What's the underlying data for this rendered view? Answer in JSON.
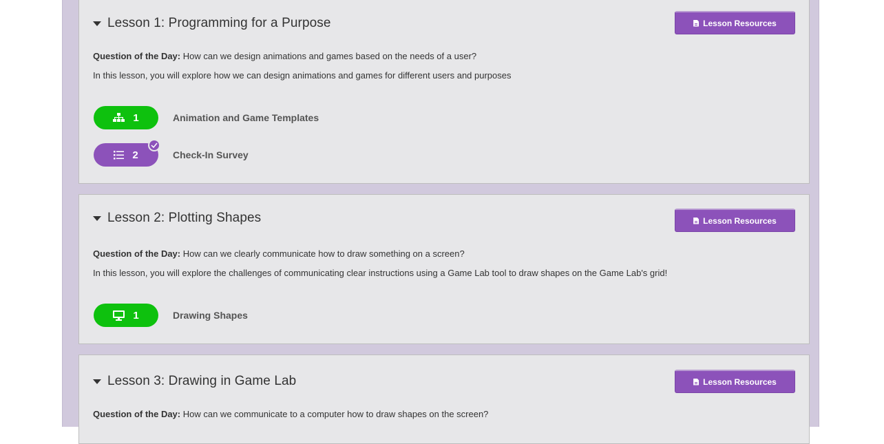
{
  "lessons": [
    {
      "title": "Lesson 1: Programming for a Purpose",
      "resources_label": "Lesson Resources",
      "qotd_label": "Question of the Day:",
      "qotd_text": " How can we design animations and games based on the needs of a user?",
      "description": "In this lesson, you will explore how we can design animations and games for different users and purposes",
      "activities": [
        {
          "number": "1",
          "label": "Animation and Game Templates",
          "icon": "sitemap-icon",
          "color": "#0ec10e",
          "completed": false
        },
        {
          "number": "2",
          "label": "Check-In Survey",
          "icon": "list-icon",
          "color": "#8c52ba",
          "completed": true
        }
      ]
    },
    {
      "title": "Lesson 2: Plotting Shapes",
      "resources_label": "Lesson Resources",
      "qotd_label": "Question of the Day:",
      "qotd_text": " How can we clearly communicate how to draw something on a screen?",
      "description": "In this lesson, you will explore the challenges of communicating clear instructions using a Game Lab tool to draw shapes on the Game Lab's grid!",
      "activities": [
        {
          "number": "1",
          "label": "Drawing Shapes",
          "icon": "desktop-icon",
          "color": "#0ec10e",
          "completed": false
        }
      ]
    },
    {
      "title": "Lesson 3: Drawing in Game Lab",
      "resources_label": "Lesson Resources",
      "qotd_label": "Question of the Day:",
      "qotd_text": " How can we communicate to a computer how to draw shapes on the screen?"
    }
  ],
  "colors": {
    "accent_purple": "#8c52ba",
    "level_green": "#0ec10e",
    "panel_bg": "#e7e7e9",
    "outer_bg": "#d1c9dd"
  }
}
